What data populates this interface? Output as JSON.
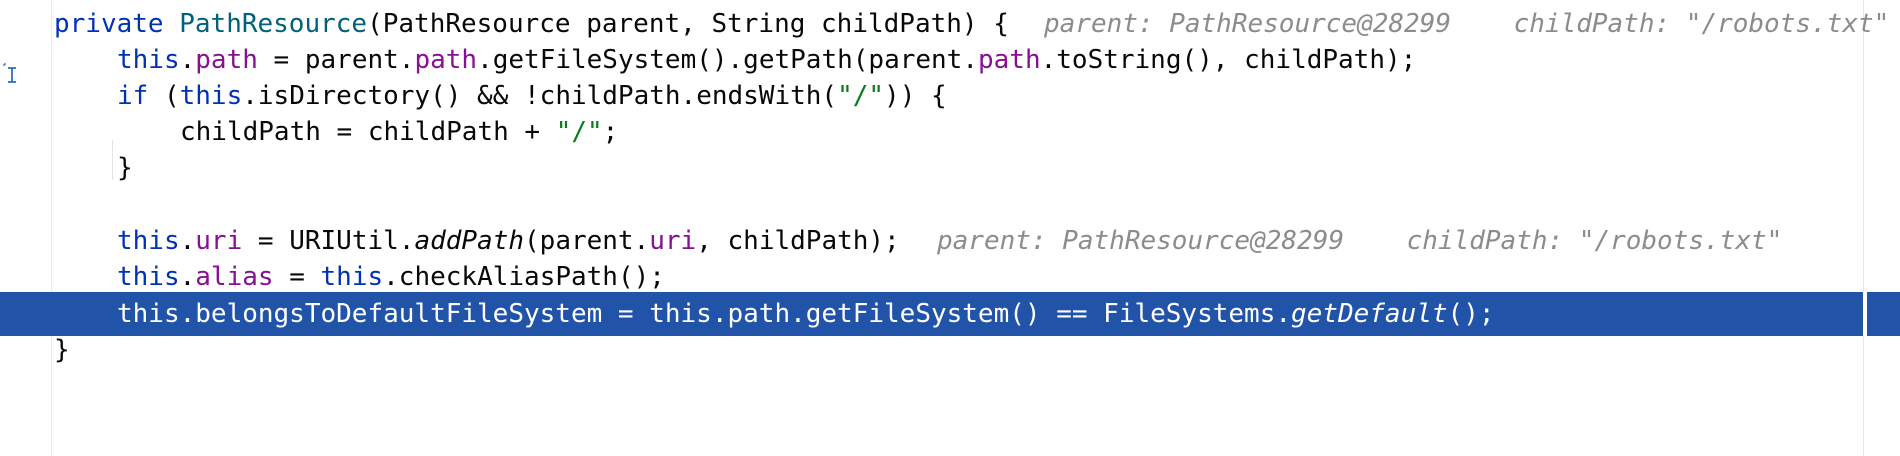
{
  "editor": {
    "lines": [
      {
        "tokens": [
          {
            "t": "private ",
            "c": "kw"
          },
          {
            "t": "PathResource",
            "c": "typ"
          },
          {
            "t": "(PathResource parent, String childPath) {",
            "c": ""
          }
        ],
        "hints": "parent: PathResource@28299    childPath: \"/robots.txt\""
      },
      {
        "tokens": [
          {
            "t": "this",
            "c": "kw"
          },
          {
            "t": ".",
            "c": ""
          },
          {
            "t": "path",
            "c": "fld"
          },
          {
            "t": " = parent.",
            "c": ""
          },
          {
            "t": "path",
            "c": "fld"
          },
          {
            "t": ".getFileSystem().getPath(parent.",
            "c": ""
          },
          {
            "t": "path",
            "c": "fld"
          },
          {
            "t": ".toString(), childPath);",
            "c": ""
          }
        ],
        "hints": ""
      },
      {
        "tokens": [
          {
            "t": "if",
            "c": "kw"
          },
          {
            "t": " (",
            "c": ""
          },
          {
            "t": "this",
            "c": "kw"
          },
          {
            "t": ".isDirectory() && !childPath.endsWith(",
            "c": ""
          },
          {
            "t": "\"/\"",
            "c": "str"
          },
          {
            "t": ")) {",
            "c": ""
          }
        ],
        "hints": ""
      },
      {
        "tokens": [
          {
            "t": "childPath = childPath + ",
            "c": ""
          },
          {
            "t": "\"/\"",
            "c": "str"
          },
          {
            "t": ";",
            "c": ""
          }
        ],
        "hints": ""
      },
      {
        "tokens": [
          {
            "t": "}",
            "c": ""
          }
        ],
        "hints": ""
      },
      {
        "tokens": [],
        "hints": ""
      },
      {
        "tokens": [
          {
            "t": "this",
            "c": "kw"
          },
          {
            "t": ".",
            "c": ""
          },
          {
            "t": "uri",
            "c": "fld"
          },
          {
            "t": " = URIUtil.",
            "c": ""
          },
          {
            "t": "addPath",
            "c": "it"
          },
          {
            "t": "(parent.",
            "c": ""
          },
          {
            "t": "uri",
            "c": "fld"
          },
          {
            "t": ", childPath);",
            "c": ""
          }
        ],
        "hints": "parent: PathResource@28299    childPath: \"/robots.txt\""
      },
      {
        "tokens": [
          {
            "t": "this",
            "c": "kw"
          },
          {
            "t": ".",
            "c": ""
          },
          {
            "t": "alias",
            "c": "fld"
          },
          {
            "t": " = ",
            "c": ""
          },
          {
            "t": "this",
            "c": "kw"
          },
          {
            "t": ".checkAliasPath();",
            "c": ""
          }
        ],
        "hints": ""
      },
      {
        "tokens": [
          {
            "t": "this.belongsToDefaultFileSystem = this.path.getFileSystem() == FileSystems.",
            "c": ""
          },
          {
            "t": "getDefault",
            "c": "it"
          },
          {
            "t": "();",
            "c": ""
          }
        ],
        "hints": "",
        "highlighted": true
      },
      {
        "tokens": [
          {
            "t": "}",
            "c": ""
          }
        ],
        "hints": ""
      }
    ]
  },
  "colors": {
    "keyword": "#0033b3",
    "type": "#00627a",
    "field": "#871094",
    "string": "#067d17",
    "hint": "#8c8c8c",
    "execution_line": "#2154a8"
  },
  "icons": {
    "gutter_caret": "text-cursor-icon"
  }
}
